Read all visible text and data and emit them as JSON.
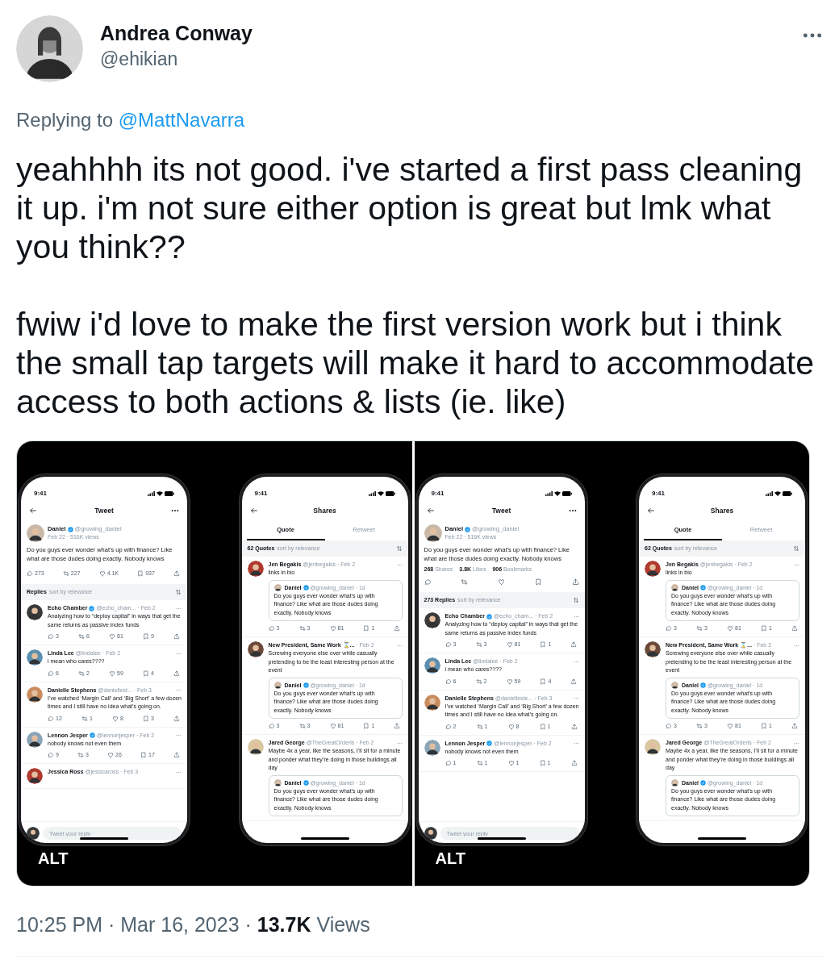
{
  "tweet": {
    "author": {
      "name": "Andrea Conway",
      "handle": "@ehikian"
    },
    "replying_to": {
      "prefix": "Replying to",
      "handle": "@MattNavarra"
    },
    "paragraphs": [
      "yeahhhh its not good. i've started a first pass cleaning it up. i'm not sure either option is great but lmk what you think??",
      "fwiw i'd love to make the first version work but i think the small tap targets will make it hard to accommodate access to both actions & lists (ie. like)"
    ],
    "media": [
      {
        "alt_badge": "ALT",
        "phones": [
          {
            "kind": "tweet",
            "time": "9:41",
            "title": "Tweet",
            "main": {
              "name": "Daniel",
              "verified": true,
              "handle": "@growing_daniel",
              "meta": "Feb 22 · 516K views",
              "text": "Do you guys ever wonder what’s up with finance? Like what are those dudes doing exactly. Nobody knows",
              "counts": [
                "273",
                "227",
                "4.1K",
                "937"
              ]
            },
            "list_header": {
              "count": "Replies",
              "label": "sort by relevance"
            },
            "replies": [
              {
                "name": "Echo Chamber",
                "verified": true,
                "meta": "@echo_cham... · Feb 2",
                "text": "Analyzing how to “deploy capital” in ways that get the same returns as passive index funds",
                "counts": [
                  "3",
                  "6",
                  "81",
                  "9"
                ]
              },
              {
                "name": "Linda Lee",
                "verified": false,
                "meta": "@lindalee · Feb 2",
                "text": "i mean who cares????",
                "counts": [
                  "6",
                  "2",
                  "59",
                  "4"
                ]
              },
              {
                "name": "Danielle Stephens",
                "verified": false,
                "meta": "@daniellest... · Feb 3",
                "text": "I’ve watched ‘Margin Call’ and ‘Big Short’ a few dozen times and I still have no idea what’s going on.",
                "counts": [
                  "12",
                  "1",
                  "8",
                  "3"
                ]
              },
              {
                "name": "Lennon Jesper",
                "verified": true,
                "meta": "@lennonjesper · Feb 2",
                "text": "nobody knows not even them",
                "counts": [
                  "9",
                  "3",
                  "26",
                  "17"
                ]
              },
              {
                "name": "Jessica Ross",
                "verified": false,
                "meta": "@jessicaross · Feb 3"
              }
            ],
            "reply_placeholder": "Tweet your reply"
          },
          {
            "kind": "shares",
            "time": "9:41",
            "title": "Shares",
            "tabs": [
              {
                "label": "Quote",
                "selected": true
              },
              {
                "label": "Retweet",
                "selected": false
              }
            ],
            "list_header": {
              "count": "62 Quotes",
              "label": "sort by relevance"
            },
            "quotes": [
              {
                "name": "Jen Begakis",
                "verified": false,
                "meta": "@jenbegakis · Feb 2",
                "text": "links in bio",
                "quoted": {
                  "name": "Daniel",
                  "verified": true,
                  "meta": "@growing_daniel · 1d",
                  "text": "Do you guys ever wonder what’s up with finance? Like what are those dudes doing exactly. Nobody knows"
                },
                "counts": [
                  "3",
                  "3",
                  "81",
                  "1"
                ]
              },
              {
                "name": "New President, Same Work ⌛...",
                "verified": false,
                "meta": "· Feb 2",
                "text": "Screwing everyone else over while casually pretending to be the least interesting person at the event",
                "quoted": {
                  "name": "Daniel",
                  "verified": true,
                  "meta": "@growing_daniel · 1d",
                  "text": "Do you guys ever wonder what’s up with finance? Like what are those dudes doing exactly. Nobody knows"
                },
                "counts": [
                  "3",
                  "3",
                  "81",
                  "1"
                ]
              },
              {
                "name": "Jared George",
                "verified": false,
                "meta": "@TheGreatOrderls · Feb 2",
                "text": "Maybe 4x a year, like the seasons, I’ll sit for a minute and ponder what they’re doing in those buildings all day",
                "quoted": {
                  "name": "Daniel",
                  "verified": true,
                  "meta": "@growing_daniel · 1d",
                  "text": "Do you guys ever wonder what’s up with finance? Like what are those dudes doing exactly. Nobody knows"
                }
              }
            ]
          }
        ]
      },
      {
        "alt_badge": "ALT",
        "phones": [
          {
            "kind": "tweet",
            "time": "9:41",
            "title": "Tweet",
            "main": {
              "name": "Daniel",
              "verified": true,
              "handle": "@growing_daniel",
              "meta": "Feb 22 · 516K views",
              "text": "Do you guys ever wonder what’s up with finance? Like what are those dudes doing exactly. Nobody knows",
              "stats": [
                "**268** Shares",
                "**3.8K** Likes",
                "**906** Bookmarks"
              ]
            },
            "list_header": {
              "count": "273 Replies",
              "label": "sort by relevance"
            },
            "replies": [
              {
                "name": "Echo Chamber",
                "verified": true,
                "meta": "@echo_cham... · Feb 2",
                "text": "Analyzing how to “deploy capital” in ways that get the same returns as passive index funds",
                "counts": [
                  "3",
                  "3",
                  "81",
                  "1"
                ]
              },
              {
                "name": "Linda Lee",
                "verified": false,
                "meta": "@lindalee · Feb 2",
                "text": "i mean who cares????",
                "counts": [
                  "6",
                  "2",
                  "59",
                  "4"
                ]
              },
              {
                "name": "Danielle Stephens",
                "verified": false,
                "meta": "@danielleste... · Feb 3",
                "text": "I’ve watched ‘Margin Call’ and ‘Big Short’ a few dozen times and I still have no idea what’s going on.",
                "counts": [
                  "2",
                  "1",
                  "8",
                  "1"
                ]
              },
              {
                "name": "Lennon Jesper",
                "verified": true,
                "meta": "@lennonjesper · Feb 2",
                "text": "nobody knows not even them",
                "counts": [
                  "1",
                  "1",
                  "1",
                  "1"
                ]
              }
            ],
            "reply_placeholder": "Tweet your reply"
          },
          {
            "kind": "shares",
            "time": "9:41",
            "title": "Shares",
            "tabs": [
              {
                "label": "Quote",
                "selected": true
              },
              {
                "label": "Retweet",
                "selected": false
              }
            ],
            "list_header": {
              "count": "62 Quotes",
              "label": "sort by relevance"
            },
            "quotes": [
              {
                "name": "Jen Begakis",
                "verified": false,
                "meta": "@jenbegakis · Feb 2",
                "text": "links in bio",
                "quoted": {
                  "name": "Daniel",
                  "verified": true,
                  "meta": "@growing_daniel · 1d",
                  "text": "Do you guys ever wonder what’s up with finance? Like what are those dudes doing exactly. Nobody knows"
                },
                "counts": [
                  "3",
                  "3",
                  "81",
                  "1"
                ]
              },
              {
                "name": "New President, Same Work ⌛...",
                "verified": false,
                "meta": "· Feb 2",
                "text": "Screwing everyone else over while casually pretending to be the least interesting person at the event",
                "quoted": {
                  "name": "Daniel",
                  "verified": true,
                  "meta": "@growing_daniel · 1d",
                  "text": "Do you guys ever wonder what’s up with finance? Like what are those dudes doing exactly. Nobody knows"
                },
                "counts": [
                  "3",
                  "3",
                  "81",
                  "1"
                ]
              },
              {
                "name": "Jared George",
                "verified": false,
                "meta": "@TheGreatOrderls · Feb 2",
                "text": "Maybe 4x a year, like the seasons, I’ll sit for a minute and ponder what they’re doing in those buildings all day",
                "quoted": {
                  "name": "Daniel",
                  "verified": true,
                  "meta": "@growing_daniel · 1d",
                  "text": "Do you guys ever wonder what’s up with finance? Like what are those dudes doing exactly. Nobody knows"
                }
              }
            ]
          }
        ]
      }
    ],
    "footer": "10:25 PM · Mar 16, 2023 · **13.7K** Views"
  }
}
